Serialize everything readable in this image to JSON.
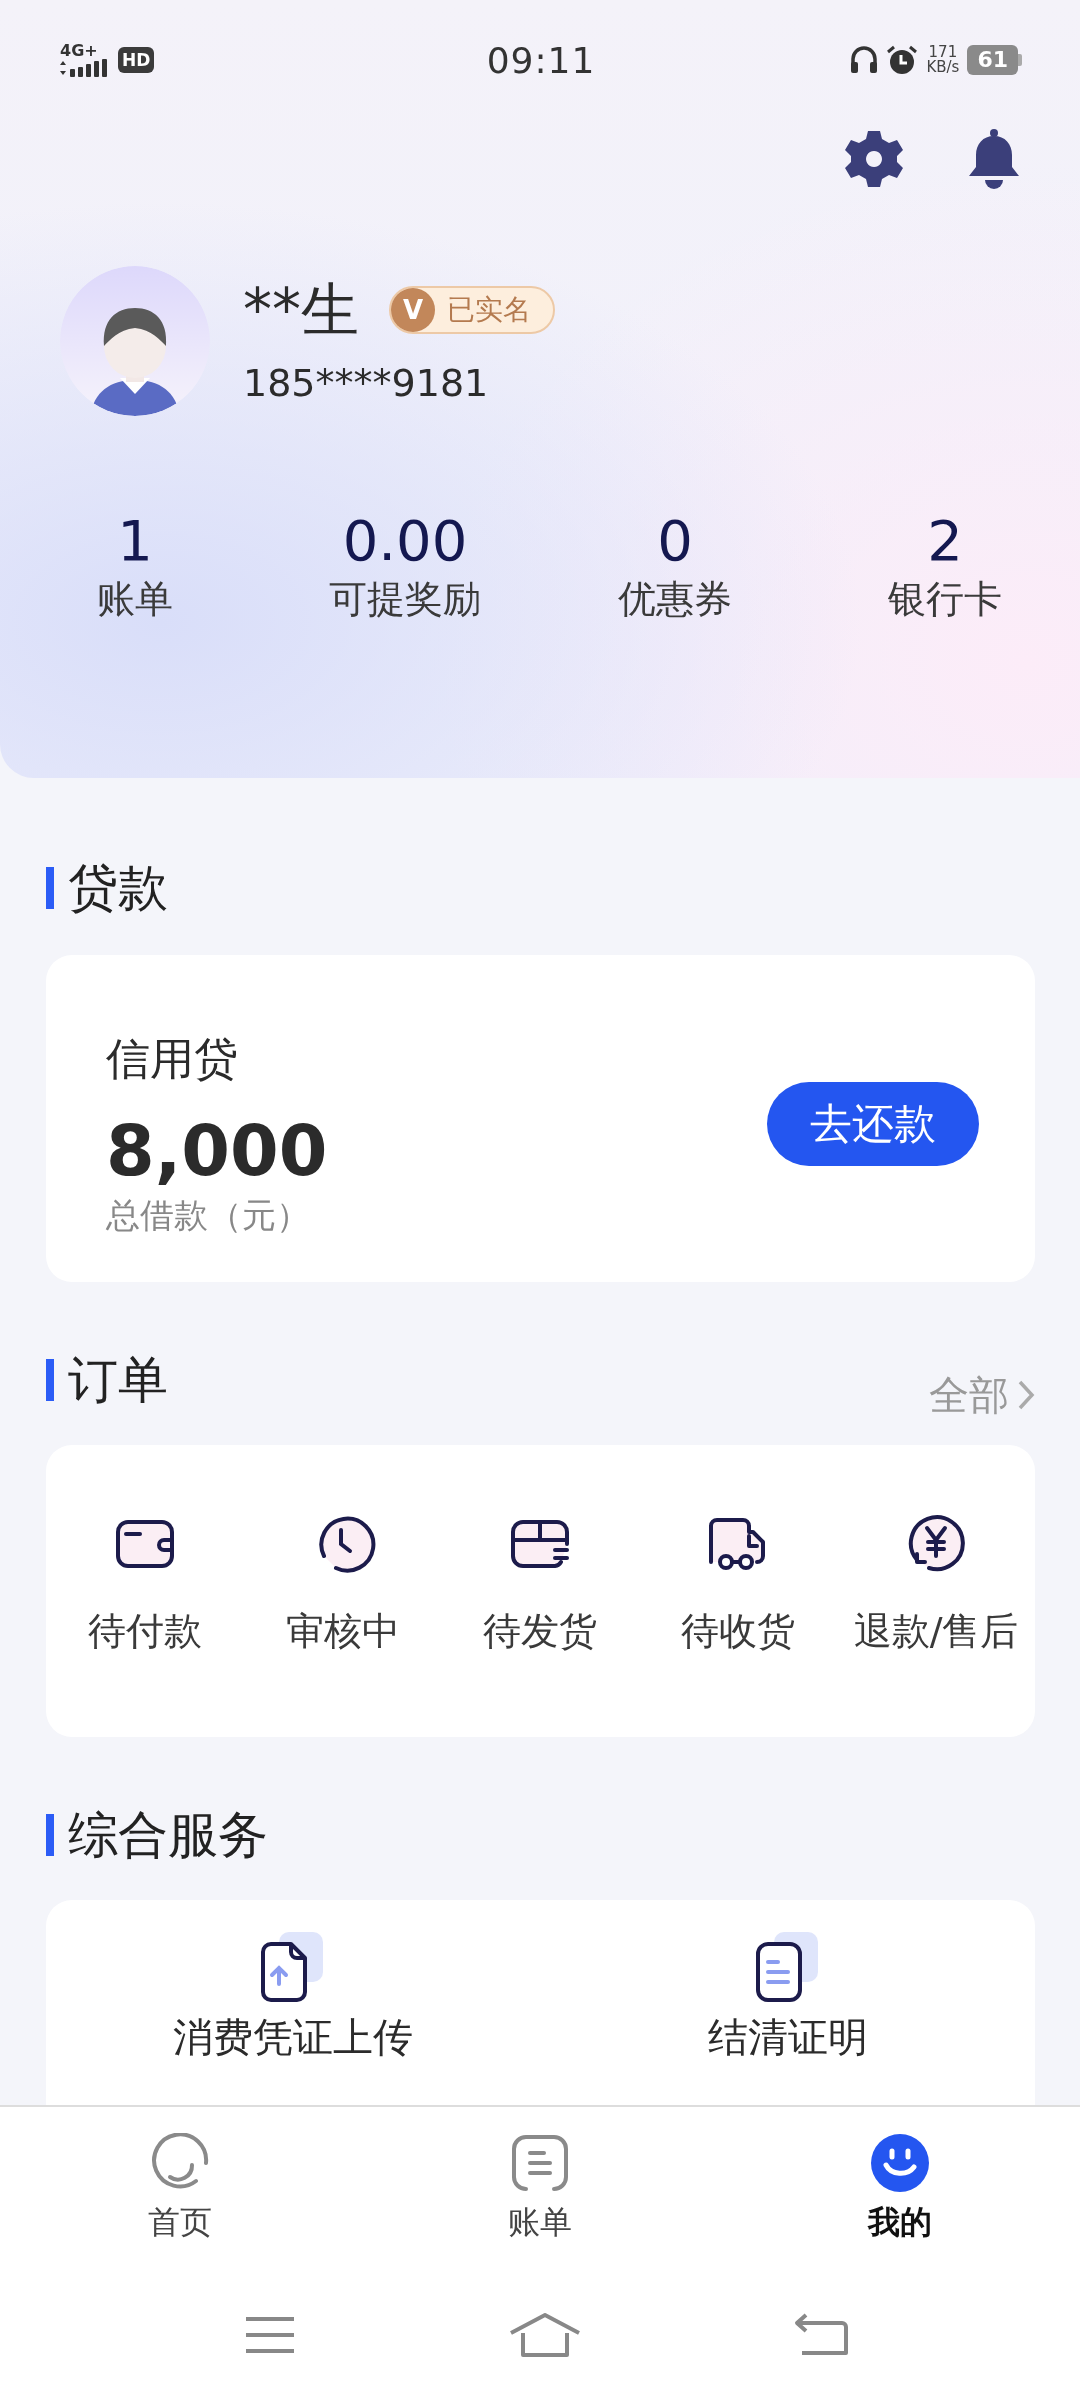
{
  "status_bar": {
    "network": "4G+",
    "hd": "HD",
    "time": "09:11",
    "speed": "171",
    "speed_unit": "KB/s",
    "battery": "61"
  },
  "profile": {
    "name": "**生",
    "badge_mark": "V",
    "badge": "已实名",
    "phone": "185****9181"
  },
  "stats": [
    {
      "value": "1",
      "label": "账单"
    },
    {
      "value": "0.00",
      "label": "可提奖励"
    },
    {
      "value": "0",
      "label": "优惠券"
    },
    {
      "value": "2",
      "label": "银行卡"
    }
  ],
  "loan": {
    "title": "贷款",
    "product": "信用贷",
    "amount": "8,000",
    "amount_label": "总借款（元）",
    "button": "去还款"
  },
  "orders": {
    "title": "订单",
    "more": "全部",
    "items": [
      {
        "label": "待付款",
        "kind": "wallet"
      },
      {
        "label": "审核中",
        "kind": "clock"
      },
      {
        "label": "待发货",
        "kind": "box"
      },
      {
        "label": "待收货",
        "kind": "truck"
      },
      {
        "label": "退款/售后",
        "kind": "refund"
      }
    ]
  },
  "services": {
    "title": "综合服务",
    "items": [
      {
        "label": "消费凭证上传",
        "kind": "upload"
      },
      {
        "label": "结清证明",
        "kind": "document"
      }
    ]
  },
  "tab_bar": {
    "tabs": [
      {
        "label": "首页",
        "kind": "home",
        "selected": false
      },
      {
        "label": "账单",
        "kind": "bill",
        "selected": false
      },
      {
        "label": "我的",
        "kind": "mine",
        "selected": true
      }
    ]
  }
}
